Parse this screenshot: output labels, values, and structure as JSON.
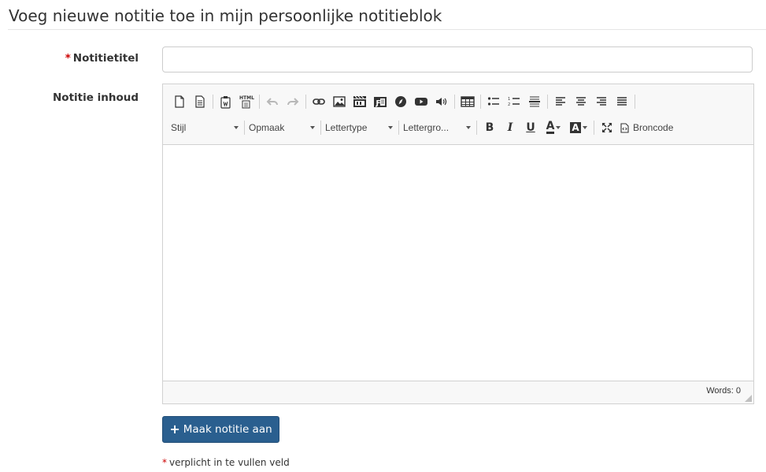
{
  "page": {
    "title": "Voeg nieuwe notitie toe in mijn persoonlijke notitieblok"
  },
  "form": {
    "required_mark": "*",
    "title_label": "Notitietitel",
    "title_value": "",
    "content_label": "Notitie inhoud"
  },
  "editor": {
    "toolbar_row1_icons": [
      "new-page-icon",
      "preview-icon",
      "paste-word-icon",
      "paste-html-icon",
      "undo-icon",
      "redo-icon",
      "link-icon",
      "image-icon",
      "video-icon",
      "flash-icon",
      "compass-icon",
      "youtube-icon",
      "audio-icon",
      "table-icon",
      "bulleted-list-icon",
      "numbered-list-icon",
      "horizontal-line-icon",
      "align-left-icon",
      "align-center-icon",
      "align-right-icon",
      "justify-icon"
    ],
    "styles_combo": "Stijl",
    "format_combo": "Opmaak",
    "font_combo": "Lettertype",
    "size_combo": "Lettergro...",
    "bold": "B",
    "italic": "I",
    "underline": "U",
    "text_color": "A",
    "bg_color": "A",
    "source_label": "Broncode",
    "word_count": "Words: 0"
  },
  "actions": {
    "submit_label": "Maak notitie aan",
    "submit_icon": "+"
  },
  "footnote": {
    "text": "verplicht in te vullen veld"
  },
  "colors": {
    "primary": "#2a5f8f",
    "required": "#cc0000"
  }
}
